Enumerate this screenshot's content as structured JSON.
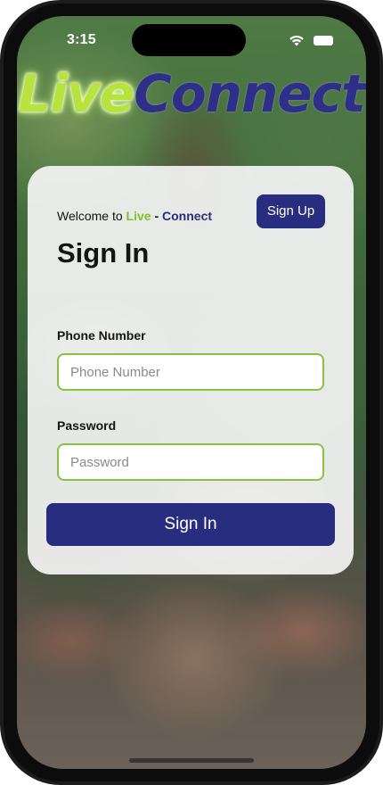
{
  "status_bar": {
    "time": "3:15",
    "wifi_icon": "wifi-icon",
    "battery_icon": "battery-icon"
  },
  "logo": {
    "live": "Live",
    "connect": "Connect"
  },
  "card": {
    "welcome_prefix": "Welcome to ",
    "welcome_live": "Live",
    "welcome_dash": " - ",
    "welcome_connect": "Connect",
    "signup_label": "Sign Up",
    "title": "Sign In",
    "phone_label": "Phone Number",
    "phone_placeholder": "Phone Number",
    "password_label": "Password",
    "password_placeholder": "Password",
    "signin_label": "Sign In"
  },
  "colors": {
    "primary": "#282d7f",
    "accent_green": "#86c440",
    "logo_live": "#b8e23c",
    "logo_connect": "#2d2f8a"
  }
}
